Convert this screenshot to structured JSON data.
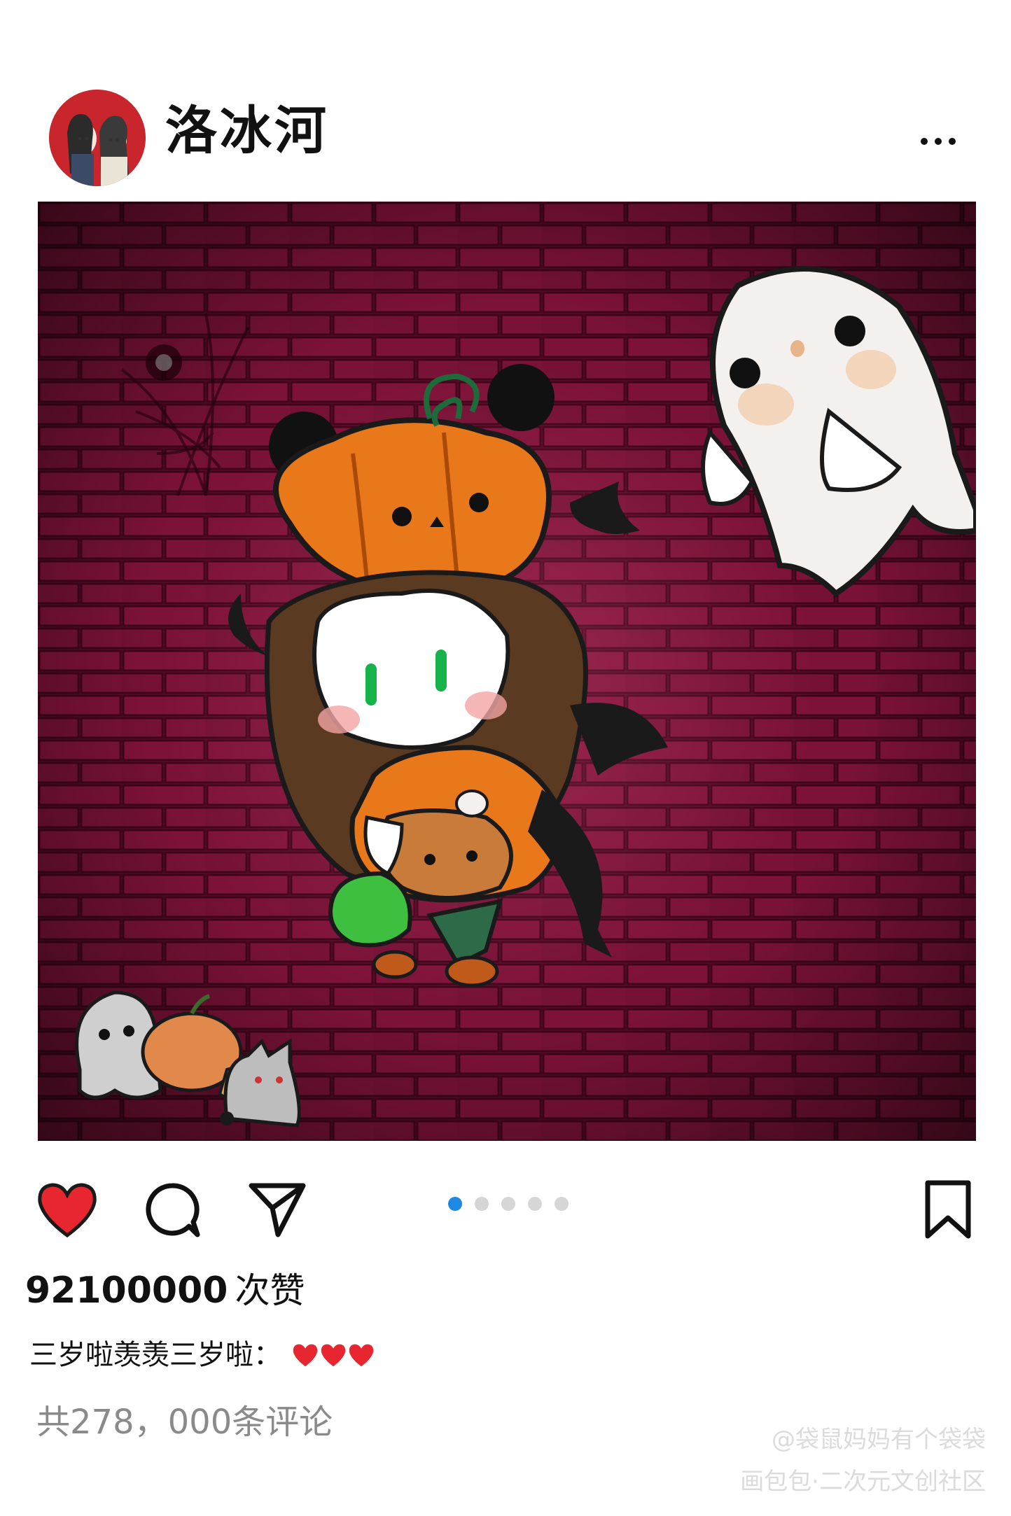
{
  "header": {
    "username": "洛冰河"
  },
  "post": {
    "carousel": {
      "count": 5,
      "active_index": 0
    },
    "likes": {
      "count": "92100000",
      "unit": "次赞"
    },
    "caption": {
      "text": "三岁啦羡羡三岁啦：",
      "emoji": "❤️❤️❤️"
    },
    "comments": {
      "text": "共278，000条评论"
    }
  },
  "watermark": {
    "line1": "@袋鼠妈妈有个袋袋",
    "line2": "画包包·二次元文创社区"
  },
  "colors": {
    "like_heart": "#e8262f",
    "carousel_active": "#1e88e5",
    "carousel_inactive": "#d6d6d6",
    "brick_wall": "#5a0a28"
  },
  "icons": {
    "more": "more-horizontal-icon",
    "like": "heart-filled-icon",
    "comment": "comment-bubble-icon",
    "share": "paper-plane-icon",
    "save": "bookmark-icon"
  }
}
